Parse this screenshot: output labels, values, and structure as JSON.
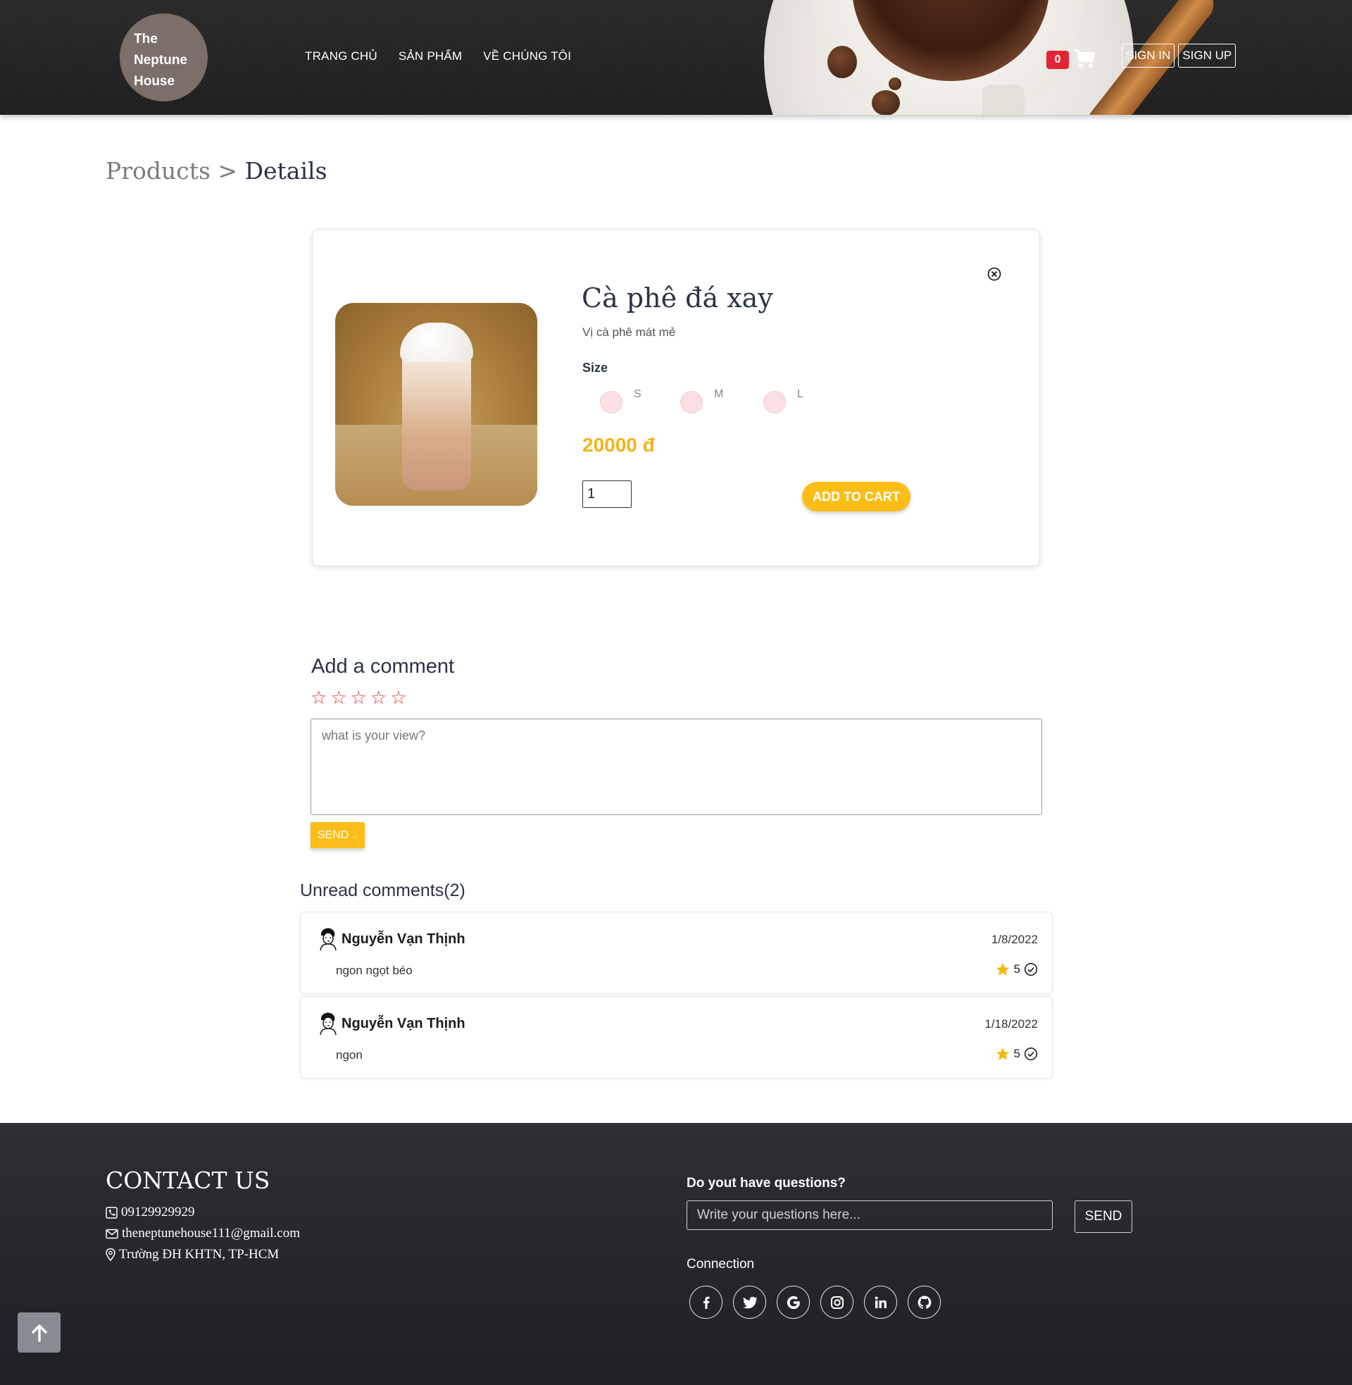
{
  "header": {
    "logo_lines": [
      "The",
      "Neptune",
      "House"
    ],
    "nav": [
      "TRANG CHỦ",
      "SẢN PHẨM",
      "VỀ CHÚNG TÔI"
    ],
    "cart_count": "0",
    "sign_in": "SIGN IN",
    "sign_up": "SIGN UP"
  },
  "breadcrumb": {
    "parent": "Products",
    "separator": ">",
    "current": "Details"
  },
  "product": {
    "name": "Cà phê đá xay",
    "description": "Vị cà phê mát mẻ",
    "size_label": "Size",
    "sizes": [
      "S",
      "M",
      "L"
    ],
    "price": "20000 đ",
    "quantity": "1",
    "add_to_cart": "ADD TO CART"
  },
  "comment_form": {
    "title": "Add a comment",
    "stars": [
      "☆",
      "☆",
      "☆",
      "☆",
      "☆"
    ],
    "placeholder": "what is your view?",
    "send": "SEND"
  },
  "comments": {
    "title": "Unread comments(2)",
    "items": [
      {
        "name": "Nguyễn Vạn Thịnh",
        "date": "1/8/2022",
        "text": "ngon ngọt béo",
        "rating": "5"
      },
      {
        "name": "Nguyễn Vạn Thịnh",
        "date": "1/18/2022",
        "text": "ngon",
        "rating": "5"
      }
    ]
  },
  "footer": {
    "contact_title": "CONTACT US",
    "phone": "09129929929",
    "email": "theneptunehouse111@gmail.com",
    "address": "Trường ĐH KHTN, TP-HCM",
    "question_title": "Do yout have questions?",
    "question_placeholder": "Write your questions here...",
    "question_send": "SEND",
    "connection_title": "Connection",
    "socials": [
      "facebook-icon",
      "twitter-icon",
      "google-icon",
      "instagram-icon",
      "linkedin-icon",
      "github-icon"
    ]
  },
  "colors": {
    "accent": "#fcbd19",
    "badge": "#e22534",
    "text": "#2b3445",
    "footer": "#2e2e33"
  }
}
